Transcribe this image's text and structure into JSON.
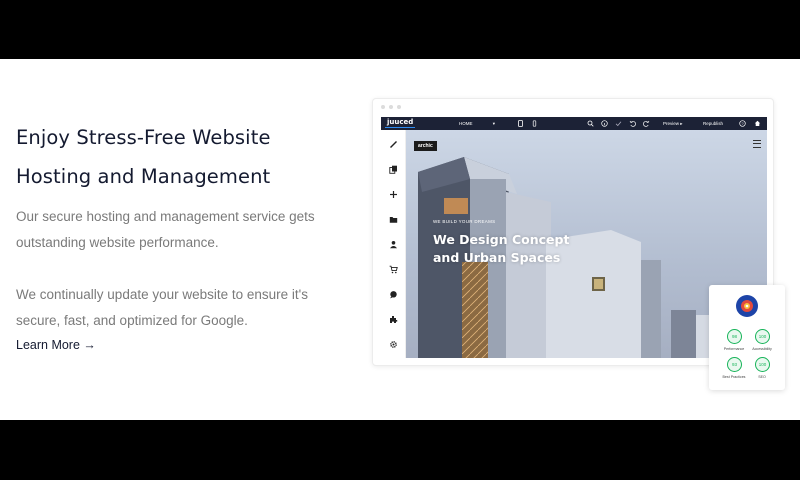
{
  "section": {
    "headline": "Enjoy Stress-Free Website Hosting and Management",
    "paragraph1": "Our secure hosting and management service gets outstanding website performance.",
    "paragraph2": "We continually update your website to ensure it's secure, fast, and optimized for Google.",
    "cta_label": "Learn More →"
  },
  "editor": {
    "logo": "juuced",
    "page_select": "HOME",
    "preview_label": "Preview",
    "republish_label": "Republish",
    "sidebar_icons": [
      "brush-icon",
      "pages-icon",
      "plus-icon",
      "folder-icon",
      "user-icon",
      "cart-icon",
      "chat-icon",
      "plugin-icon",
      "gear-icon"
    ]
  },
  "site_preview": {
    "logo": "archic",
    "kicker": "WE BUILD YOUR DREAMS",
    "hero_title": "We Design Concept and Urban Spaces"
  },
  "scores": {
    "items": [
      {
        "value": "98",
        "label": "Performance"
      },
      {
        "value": "100",
        "label": "Accessibility"
      },
      {
        "value": "93",
        "label": "Best Practices"
      },
      {
        "value": "100",
        "label": "SEO"
      }
    ]
  },
  "colors": {
    "topbar": "#1c2236",
    "headline": "#141a30",
    "body_text": "#7a7a7a",
    "score_green": "#18b45a"
  }
}
